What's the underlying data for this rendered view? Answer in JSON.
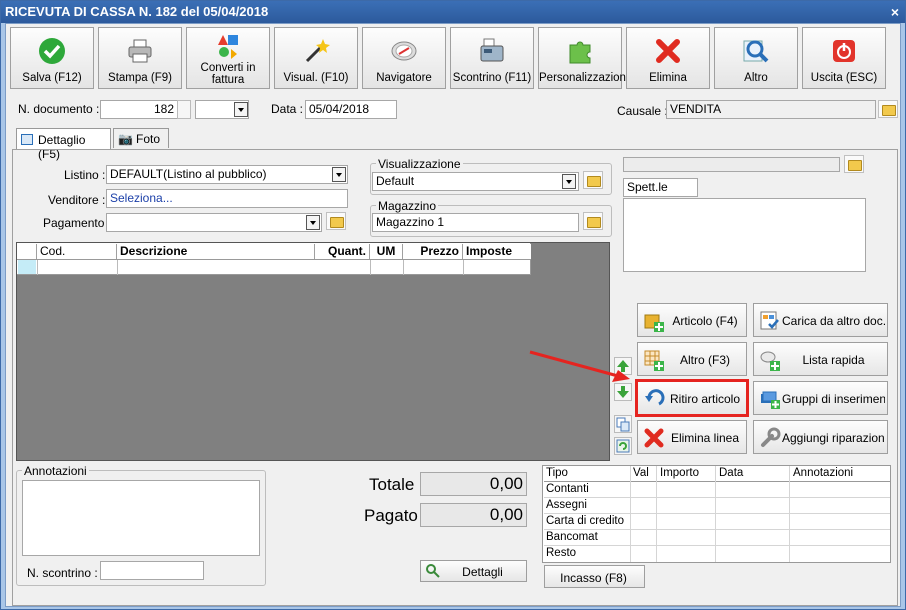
{
  "window": {
    "title": "RICEVUTA DI CASSA N. 182 del 05/04/2018",
    "close": "×"
  },
  "toolbar": [
    {
      "label": "Salva (F12)",
      "icon": "check-icon"
    },
    {
      "label": "Stampa (F9)",
      "icon": "printer-icon"
    },
    {
      "label": "Converti in fattura",
      "icon": "convert-icon"
    },
    {
      "label": "Visual. (F10)",
      "icon": "magic-wand-icon"
    },
    {
      "label": "Navigatore",
      "icon": "compass-icon"
    },
    {
      "label": "Scontrino (F11)",
      "icon": "cash-register-icon"
    },
    {
      "label": "Personalizzazioni",
      "icon": "puzzle-icon"
    },
    {
      "label": "Elimina",
      "icon": "delete-icon"
    },
    {
      "label": "Altro",
      "icon": "magnifier-icon"
    },
    {
      "label": "Uscita (ESC)",
      "icon": "power-icon"
    }
  ],
  "header": {
    "doc_label": "N. documento :",
    "doc_number": "182",
    "doc_suffix": "",
    "date_label": "Data :",
    "date_value": "05/04/2018",
    "causale_label": "Causale :",
    "causale_value": "VENDITA"
  },
  "tabs": [
    {
      "label": "Dettaglio (F5)"
    },
    {
      "label": "Foto"
    }
  ],
  "form": {
    "listino_label": "Listino :",
    "listino_value": "DEFAULT(Listino al pubblico)",
    "venditore_label": "Venditore :",
    "venditore_value": "Seleziona...",
    "pagamento_label": "Pagamento :",
    "pagamento_value": "",
    "visualizzazione_title": "Visualizzazione",
    "visualizzazione_value": "Default",
    "magazzino_title": "Magazzino",
    "magazzino_value": "Magazzino 1"
  },
  "client": {
    "search_value": "",
    "salutation": "Spett.le",
    "address": ""
  },
  "grid": {
    "columns": [
      "Cod.",
      "Descrizione",
      "Quant.",
      "UM",
      "Prezzo",
      "Imposte"
    ]
  },
  "actions": [
    {
      "label": "Articolo (F4)",
      "icon": "box-add-icon"
    },
    {
      "label": "Carica da altro doc.",
      "icon": "document-check-icon"
    },
    {
      "label": "Altro (F3)",
      "icon": "grid-add-icon"
    },
    {
      "label": "Lista rapida",
      "icon": "list-add-icon"
    },
    {
      "label": "Ritiro articolo",
      "icon": "undo-arrow-icon"
    },
    {
      "label": "Gruppi di inserimento",
      "icon": "group-add-icon"
    },
    {
      "label": "Elimina linea",
      "icon": "delete-line-icon"
    },
    {
      "label": "Aggiungi riparazione",
      "icon": "wrench-icon"
    }
  ],
  "notes": {
    "title": "Annotazioni",
    "value": "",
    "scontrino_label": "N. scontrino :",
    "scontrino_value": ""
  },
  "totals": {
    "totale_label": "Totale",
    "totale_value": "0,00",
    "pagato_label": "Pagato",
    "pagato_value": "0,00",
    "details_label": "Dettagli"
  },
  "payments": {
    "columns": [
      "Tipo",
      "Val",
      "Importo",
      "Data",
      "Annotazioni"
    ],
    "rows": [
      "Contanti",
      "Assegni",
      "Carta di credito",
      "Bancomat",
      "Resto"
    ],
    "incasso_label": "Incasso (F8)"
  },
  "colors": {
    "title_bar": "#2c5a9c",
    "highlight": "#e52420",
    "grid_bg": "#808080",
    "frame": "#a9c6e8"
  }
}
